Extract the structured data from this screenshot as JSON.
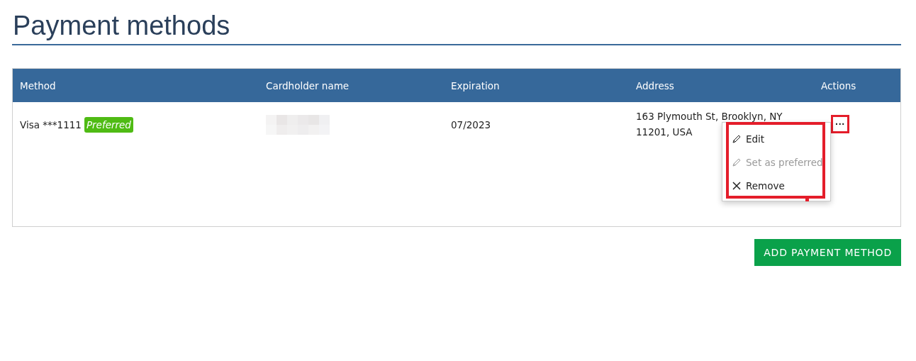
{
  "title": "Payment methods",
  "table": {
    "columns": [
      "Method",
      "Cardholder name",
      "Expiration",
      "Address",
      "Actions"
    ],
    "rows": [
      {
        "method": "Visa ***1111",
        "badge": "Preferred",
        "cardholder": {
          "kind": "redacted"
        },
        "expiration": "07/2023",
        "address": [
          "163 Plymouth St, Brooklyn, NY",
          "11201, USA"
        ],
        "actions": "···",
        "menu_open": true
      }
    ]
  },
  "menu": [
    {
      "label": "Edit",
      "kind": "edit",
      "disabled": false
    },
    {
      "label": "Set as preferred",
      "kind": "edit",
      "disabled": true
    },
    {
      "label": "Remove",
      "kind": "remove",
      "disabled": false
    }
  ],
  "add_button": "ADD PAYMENT METHOD"
}
